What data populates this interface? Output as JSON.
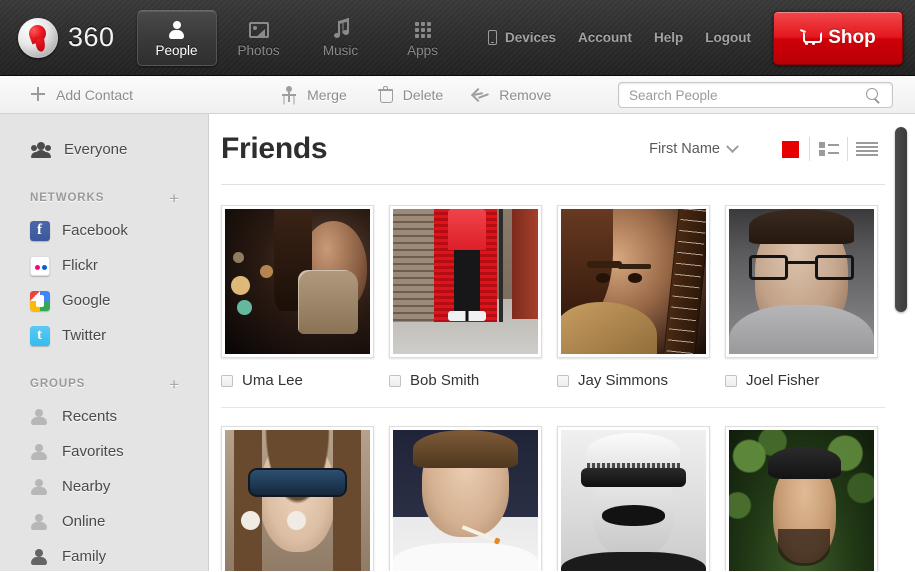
{
  "header": {
    "brand": "360",
    "logo_icon": "vodafone-logo-icon",
    "nav_tabs": [
      {
        "label": "People",
        "icon": "person-icon",
        "active": true
      },
      {
        "label": "Photos",
        "icon": "photo-icon",
        "active": false
      },
      {
        "label": "Music",
        "icon": "music-note-icon",
        "active": false
      },
      {
        "label": "Apps",
        "icon": "apps-grid-icon",
        "active": false
      }
    ],
    "links": [
      {
        "label": "Devices",
        "icon": "mobile-device-icon"
      },
      {
        "label": "Account",
        "icon": ""
      },
      {
        "label": "Help",
        "icon": ""
      },
      {
        "label": "Logout",
        "icon": ""
      }
    ],
    "shop_label": "Shop",
    "shop_icon": "shopping-cart-icon",
    "accent_red": "#e4171d"
  },
  "toolbar": {
    "add_contact": "Add Contact",
    "merge": "Merge",
    "delete": "Delete",
    "remove": "Remove",
    "search_placeholder": "Search People",
    "search_value": ""
  },
  "sidebar": {
    "everyone": "Everyone",
    "networks_header": "NETWORKS",
    "networks_add": "+",
    "networks": [
      {
        "label": "Facebook",
        "icon": "facebook-icon"
      },
      {
        "label": "Flickr",
        "icon": "flickr-icon"
      },
      {
        "label": "Google",
        "icon": "google-icon"
      },
      {
        "label": "Twitter",
        "icon": "twitter-icon"
      }
    ],
    "groups_header": "GROUPS",
    "groups_add": "+",
    "groups": [
      {
        "label": "Recents",
        "icon": "person-icon",
        "active": false
      },
      {
        "label": "Favorites",
        "icon": "person-icon",
        "active": false
      },
      {
        "label": "Nearby",
        "icon": "person-icon",
        "active": false
      },
      {
        "label": "Online",
        "icon": "person-icon",
        "active": false
      },
      {
        "label": "Family",
        "icon": "person-icon",
        "active": true
      }
    ]
  },
  "main": {
    "title": "Friends",
    "sort_label": "First Name",
    "sort_caret_icon": "chevron-down-icon",
    "views": [
      {
        "name": "grid-view",
        "icon": "grid-view-icon",
        "active": true
      },
      {
        "name": "list-view",
        "icon": "list-thumbnail-icon",
        "active": false
      },
      {
        "name": "rows-view",
        "icon": "list-rows-icon",
        "active": false
      }
    ],
    "contacts_row1": [
      {
        "name": "Uma Lee",
        "photo": "p1",
        "checked": false
      },
      {
        "name": "Bob Smith",
        "photo": "p2",
        "checked": false
      },
      {
        "name": "Jay Simmons",
        "photo": "p3",
        "checked": false
      },
      {
        "name": "Joel Fisher",
        "photo": "p4",
        "checked": false
      }
    ],
    "contacts_row2": [
      {
        "name": "",
        "photo": "p5",
        "checked": false
      },
      {
        "name": "",
        "photo": "p6",
        "checked": false
      },
      {
        "name": "",
        "photo": "p7",
        "checked": false
      },
      {
        "name": "",
        "photo": "p8",
        "checked": false
      }
    ]
  }
}
